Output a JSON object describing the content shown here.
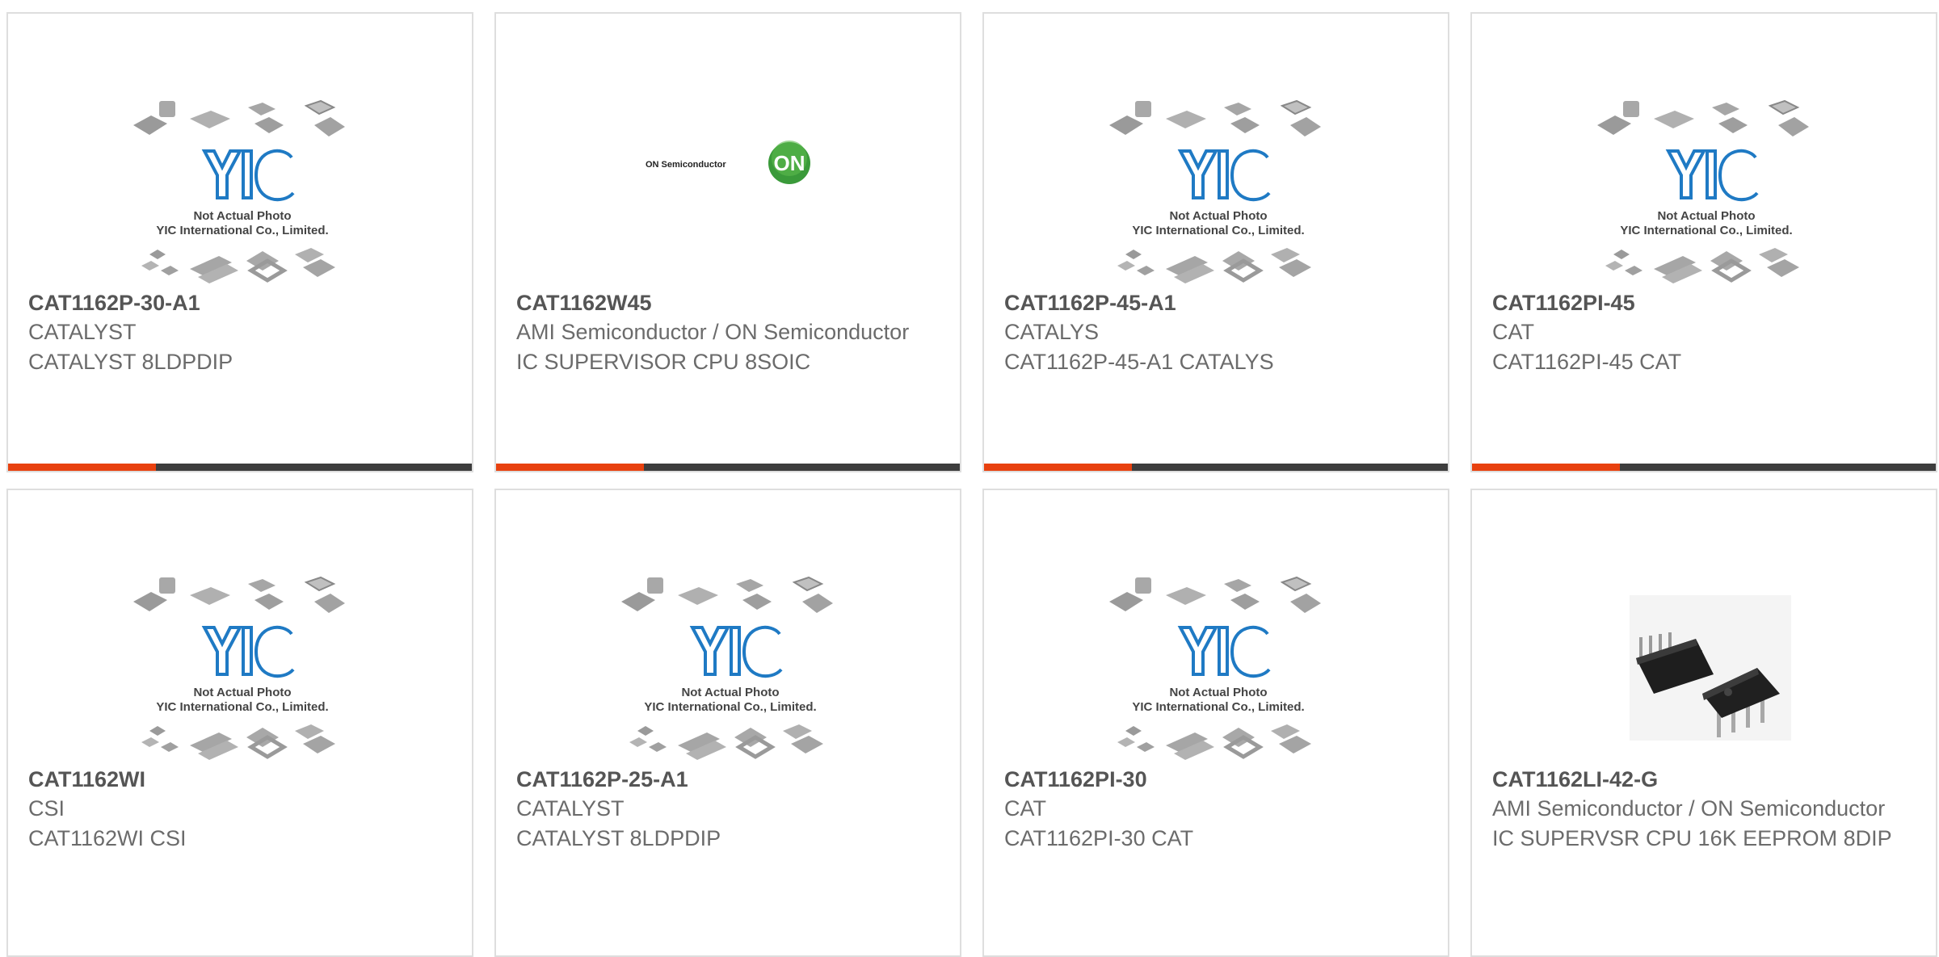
{
  "colors": {
    "accent": "#e8410f",
    "bar_base": "#3d3d3d",
    "card_border": "#dedede",
    "yic_blue": "#1f7ac4"
  },
  "placeholder": {
    "line1": "Not Actual Photo",
    "line2": "YIC International Co., Limited.",
    "logo_text": "YIC"
  },
  "onsemi_logo": {
    "text": "ON Semiconductor",
    "badge": "ON"
  },
  "products": [
    {
      "part": "CAT1162P-30-A1",
      "manufacturer": "CATALYST",
      "description": "CATALYST 8LDPDIP",
      "image": "placeholder"
    },
    {
      "part": "CAT1162W45",
      "manufacturer": "AMI Semiconductor / ON Semiconductor",
      "description": "IC SUPERVISOR CPU 8SOIC",
      "image": "onsemi-logo"
    },
    {
      "part": "CAT1162P-45-A1",
      "manufacturer": "CATALYS",
      "description": "CAT1162P-45-A1 CATALYS",
      "image": "placeholder"
    },
    {
      "part": "CAT1162PI-45",
      "manufacturer": "CAT",
      "description": "CAT1162PI-45 CAT",
      "image": "placeholder"
    },
    {
      "part": "CAT1162WI",
      "manufacturer": "CSI",
      "description": "CAT1162WI CSI",
      "image": "placeholder"
    },
    {
      "part": "CAT1162P-25-A1",
      "manufacturer": "CATALYST",
      "description": "CATALYST 8LDPDIP",
      "image": "placeholder"
    },
    {
      "part": "CAT1162PI-30",
      "manufacturer": "CAT",
      "description": "CAT1162PI-30 CAT",
      "image": "placeholder"
    },
    {
      "part": "CAT1162LI-42-G",
      "manufacturer": "AMI Semiconductor / ON Semiconductor",
      "description": "IC SUPERVSR CPU 16K EEPROM 8DIP",
      "image": "dip-chip-photo"
    }
  ]
}
